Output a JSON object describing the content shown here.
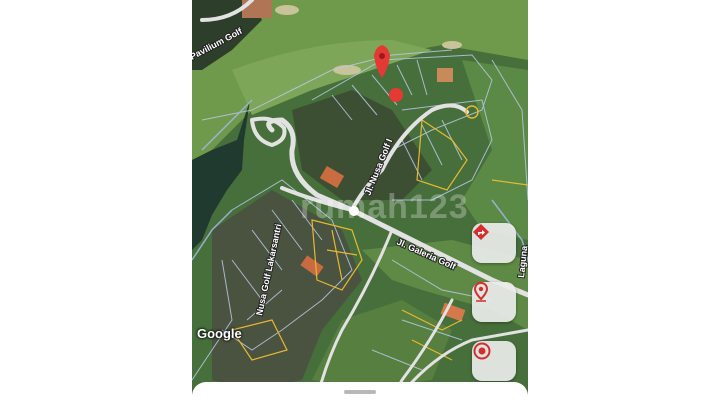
{
  "map": {
    "streets": {
      "pavilium_golf": "Pavilium Golf",
      "nusa_golf_i": "Jl. Nusa Golf I",
      "galeria_golf": "Jl. Galeria Golf",
      "lakarsantri": "Nusa Golf Lakarsantri",
      "laguna": "Laguna Golf",
      "laguna_top": "Laguna"
    },
    "watermark": "rumah123",
    "attribution": "Google",
    "pin_color": "#e53935"
  },
  "controls": {
    "directions_icon": "directions-icon",
    "location_icon": "location-pin-icon",
    "my_location_icon": "my-location-icon"
  }
}
